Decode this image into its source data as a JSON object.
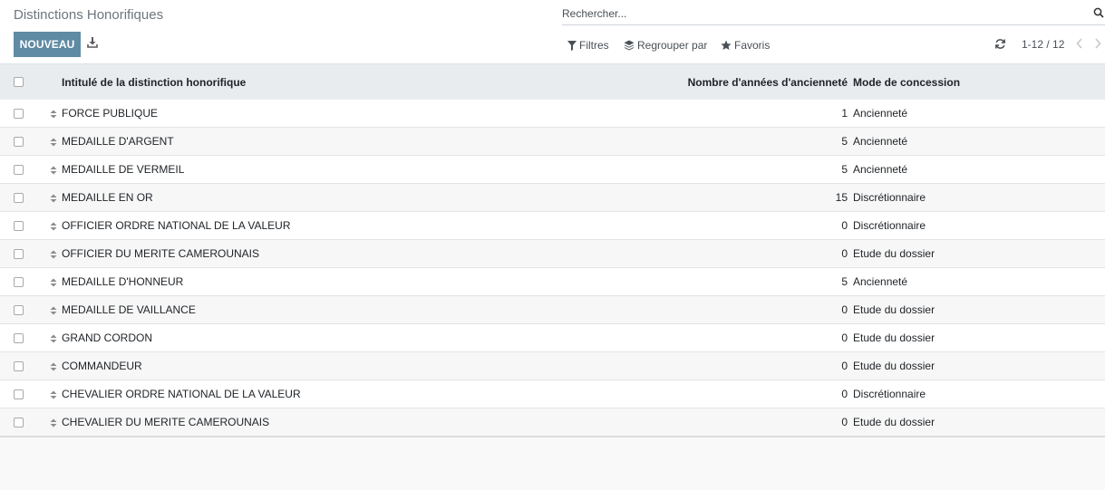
{
  "page": {
    "title": "Distinctions Honorifiques",
    "new_button": "NOUVEAU",
    "download_icon": "download-icon"
  },
  "search": {
    "placeholder": "Rechercher...",
    "value": ""
  },
  "controls": {
    "filters": "Filtres",
    "group_by": "Regrouper par",
    "favorites": "Favoris"
  },
  "pager": {
    "value": "1-12 / 12"
  },
  "table": {
    "headers": {
      "name": "Intitulé de la distinction honorifique",
      "years": "Nombre d'années d'ancienneté",
      "mode": "Mode de concession"
    },
    "rows": [
      {
        "name": "FORCE PUBLIQUE",
        "years": "1",
        "mode": "Ancienneté"
      },
      {
        "name": "MEDAILLE D'ARGENT",
        "years": "5",
        "mode": "Ancienneté"
      },
      {
        "name": "MEDAILLE DE VERMEIL",
        "years": "5",
        "mode": "Ancienneté"
      },
      {
        "name": "MEDAILLE EN OR",
        "years": "15",
        "mode": "Discrétionnaire"
      },
      {
        "name": "OFFICIER ORDRE NATIONAL DE LA VALEUR",
        "years": "0",
        "mode": "Discrétionnaire"
      },
      {
        "name": "OFFICIER DU MERITE CAMEROUNAIS",
        "years": "0",
        "mode": "Etude du dossier"
      },
      {
        "name": "MEDAILLE D'HONNEUR",
        "years": "5",
        "mode": "Ancienneté"
      },
      {
        "name": "MEDAILLE DE VAILLANCE",
        "years": "0",
        "mode": "Etude du dossier"
      },
      {
        "name": "GRAND CORDON",
        "years": "0",
        "mode": "Etude du dossier"
      },
      {
        "name": "COMMANDEUR",
        "years": "0",
        "mode": "Etude du dossier"
      },
      {
        "name": "CHEVALIER ORDRE NATIONAL DE LA VALEUR",
        "years": "0",
        "mode": "Discrétionnaire"
      },
      {
        "name": "CHEVALIER DU MERITE CAMEROUNAIS",
        "years": "0",
        "mode": "Etude du dossier"
      }
    ]
  },
  "colors": {
    "primary": "#5f8ba4",
    "header_bg": "#e9ecef",
    "page_bg": "#f9f9f9"
  }
}
